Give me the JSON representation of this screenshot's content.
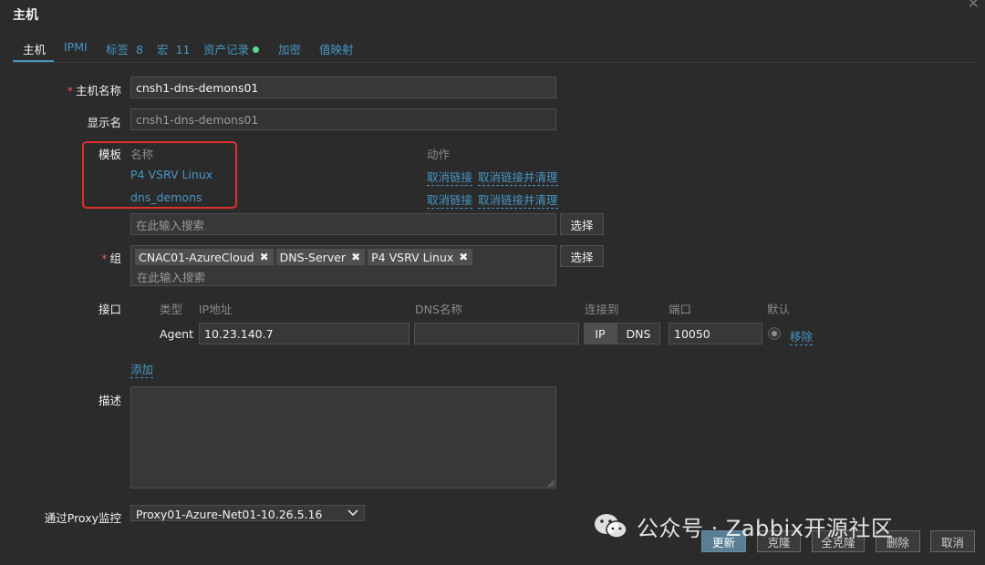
{
  "dialog": {
    "title": "主机"
  },
  "tabs": [
    {
      "label": "主机",
      "active": true
    },
    {
      "label": "IPMI"
    },
    {
      "label": "标签",
      "count": "8"
    },
    {
      "label": "宏",
      "count": "11"
    },
    {
      "label": "资产记录"
    },
    {
      "label": "加密"
    },
    {
      "label": "值映射"
    }
  ],
  "form": {
    "host_name_label": "主机名称",
    "host_name_value": "cnsh1-dns-demons01",
    "visible_name_label": "显示名",
    "visible_name_placeholder": "cnsh1-dns-demons01",
    "templates_label": "模板",
    "templates_col_name": "名称",
    "templates_col_action": "动作",
    "templates": [
      {
        "name": "P4 VSRV Linux",
        "unlink": "取消链接",
        "unlink_clear": "取消链接并清理"
      },
      {
        "name": "dns_demons",
        "unlink": "取消链接",
        "unlink_clear": "取消链接并清理"
      }
    ],
    "template_search_placeholder": "在此输入搜索",
    "select_button": "选择",
    "groups_label": "组",
    "groups": [
      "CNAC01-AzureCloud",
      "DNS-Server",
      "P4 VSRV Linux"
    ],
    "group_search_placeholder": "在此输入搜索",
    "interfaces_label": "接口",
    "interfaces_headers": {
      "type": "类型",
      "ip": "IP地址",
      "dns": "DNS名称",
      "connect": "连接到",
      "port": "端口",
      "default": "默认"
    },
    "interface": {
      "type": "Agent",
      "ip": "10.23.140.7",
      "dns": "",
      "connect_ip": "IP",
      "connect_dns": "DNS",
      "port": "10050",
      "remove": "移除"
    },
    "add_link": "添加",
    "description_label": "描述",
    "description_value": "",
    "proxy_label": "通过Proxy监控",
    "proxy_value": "Proxy01-Azure-Net01-10.26.5.16"
  },
  "footer": {
    "update": "更新",
    "clone": "克隆",
    "full_clone": "全克隆",
    "delete": "删除",
    "cancel": "取消"
  },
  "watermark": {
    "text": "公众号 · Zabbix开源社区"
  },
  "colors": {
    "accent": "#4796c4",
    "required": "#e45959",
    "highlight_box": "#e0302a",
    "status_dot": "#59db8f"
  }
}
